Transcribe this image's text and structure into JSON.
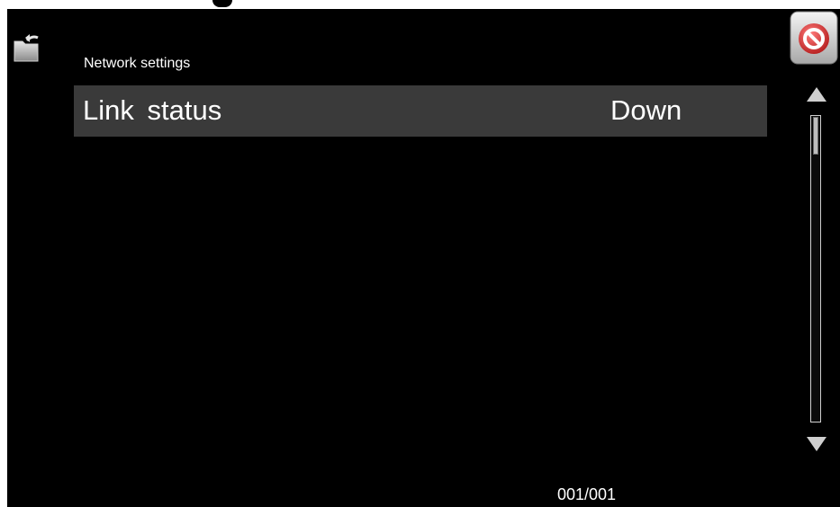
{
  "header": {
    "title": "Network settings",
    "back_icon": "back-folder-icon",
    "cancel_icon": "cancel-icon"
  },
  "rows": [
    {
      "label": "Link  status",
      "value": "Down"
    }
  ],
  "scrollbar": {
    "up_icon": "triangle-up-icon",
    "down_icon": "triangle-down-icon",
    "position": 0
  },
  "footer": {
    "page_counter": "001/001"
  },
  "colors": {
    "background": "#000000",
    "row_background": "#3a3a3a",
    "text": "#ffffff",
    "cancel_red": "#d83a3a"
  }
}
